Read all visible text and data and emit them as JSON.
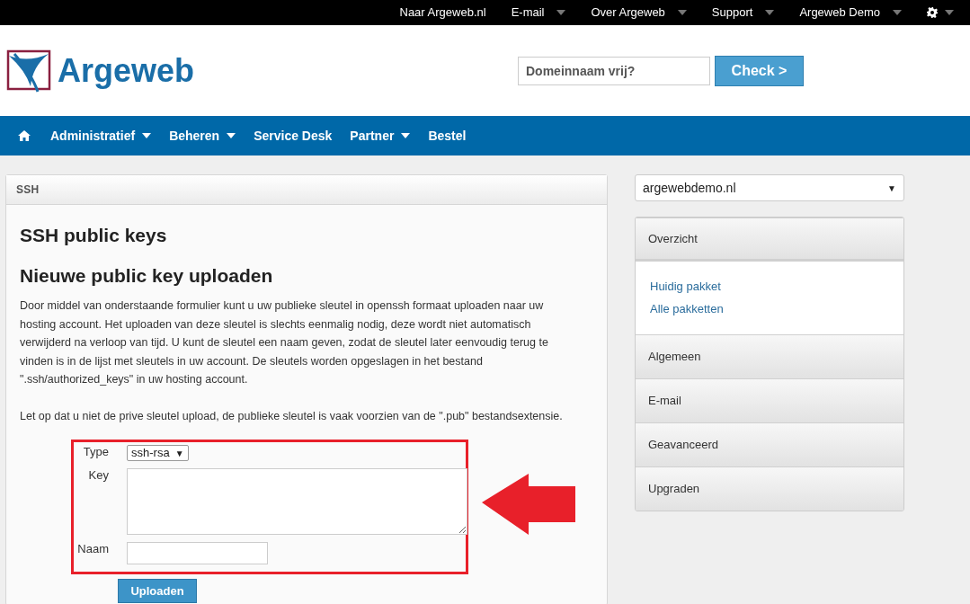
{
  "top_bar": {
    "items": [
      {
        "label": "Naar Argeweb.nl",
        "has_dropdown": false
      },
      {
        "label": "E-mail",
        "has_dropdown": true
      },
      {
        "label": "Over Argeweb",
        "has_dropdown": true
      },
      {
        "label": "Support",
        "has_dropdown": true
      },
      {
        "label": "Argeweb Demo",
        "has_dropdown": true
      }
    ],
    "settings_has_dropdown": true
  },
  "header": {
    "logo_text": "Argeweb",
    "domain_search": {
      "placeholder": "Domeinnaam vrij?"
    },
    "check_button": "Check >"
  },
  "nav": {
    "items": [
      {
        "kind": "home",
        "has_dropdown": false
      },
      {
        "kind": "link",
        "label": "Administratief",
        "has_dropdown": true
      },
      {
        "kind": "link",
        "label": "Beheren",
        "has_dropdown": true
      },
      {
        "kind": "link",
        "label": "Service Desk",
        "has_dropdown": false
      },
      {
        "kind": "link",
        "label": "Partner",
        "has_dropdown": true
      },
      {
        "kind": "link",
        "label": "Bestel",
        "has_dropdown": false
      }
    ]
  },
  "panel": {
    "title": "SSH",
    "heading": "SSH public keys",
    "subheading": "Nieuwe public key uploaden",
    "paragraphs": [
      "Door middel van onderstaande formulier kunt u uw publieke sleutel in openssh formaat uploaden naar uw hosting account. Het uploaden van deze sleutel is slechts eenmalig nodig, deze wordt niet automatisch verwijderd na verloop van tijd. U kunt de sleutel een naam geven, zodat de sleutel later eenvoudig terug te vinden is in de lijst met sleutels in uw account. De sleutels worden opgeslagen in het bestand \".ssh/authorized_keys\" in uw hosting account.",
      "Let op dat u niet de prive sleutel upload, de publieke sleutel is vaak voorzien van de \".pub\" bestandsextensie."
    ],
    "form": {
      "fields": [
        {
          "kind": "select",
          "label": "Type",
          "value": "ssh-rsa",
          "caret": "▼"
        },
        {
          "kind": "textarea",
          "label": "Key"
        },
        {
          "kind": "text",
          "label": "Naam"
        }
      ],
      "submit": "Uploaden"
    }
  },
  "sidebar": {
    "domain_select": {
      "value": "argewebdemo.nl",
      "caret": "▼"
    },
    "sections": [
      {
        "label": "Overzicht",
        "expanded": true,
        "children": [
          {
            "label": "Huidig pakket"
          },
          {
            "label": "Alle pakketten"
          }
        ]
      },
      {
        "label": "Algemeen",
        "expanded": false
      },
      {
        "label": "E-mail",
        "expanded": false
      },
      {
        "label": "Geavanceerd",
        "expanded": false
      },
      {
        "label": "Upgraden",
        "expanded": false
      }
    ]
  }
}
